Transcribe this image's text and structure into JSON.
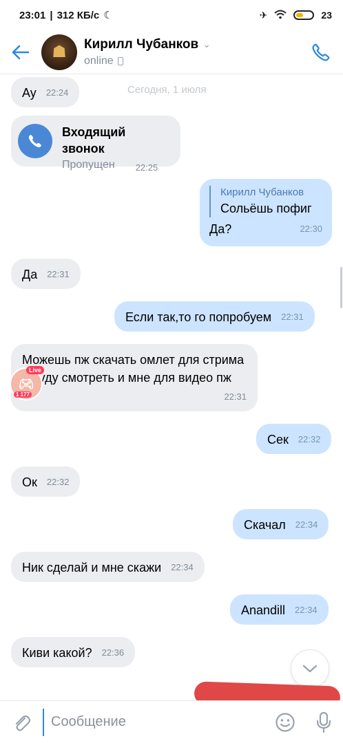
{
  "status_bar": {
    "time": "23:01",
    "speed": "312 КБ/с",
    "battery": "23"
  },
  "header": {
    "back_label": "←",
    "avatar_glyph": "☗",
    "name": "Кирилл Чубанков",
    "status": "online"
  },
  "date_label": "Сегодня, 1 июля",
  "messages": [
    {
      "text": "Ау",
      "time": "22:24"
    },
    {
      "call_title": "Входящий звонок",
      "call_status": "Пропущен",
      "time": "22:25"
    },
    {
      "reply_author": "Кирилл Чубанков",
      "reply_text": "Сольёшь пофиг",
      "text": "Да?",
      "time": "22:30"
    },
    {
      "text": "Да",
      "time": "22:31"
    },
    {
      "text": "Если так,то го попробуем",
      "time": "22:31"
    },
    {
      "text": "Можешь пж скачать омлет для стрима я буду смотреть и мне для видео пж",
      "time": "22:31"
    },
    {
      "text": "Сек",
      "time": "22:32"
    },
    {
      "text": "Ок",
      "time": "22:32"
    },
    {
      "text": "Скачал",
      "time": "22:34"
    },
    {
      "text": "Ник сделай и мне скажи",
      "time": "22:34"
    },
    {
      "text": "Anandill",
      "time": "22:34"
    },
    {
      "text": "Киви какой?",
      "time": "22:36"
    }
  ],
  "live_badge": {
    "tag": "Live",
    "count": "1 177"
  },
  "composer": {
    "placeholder": "Сообщение"
  },
  "colors": {
    "accent": "#2b88e2",
    "incoming_bubble": "#ebedf0",
    "outgoing_bubble": "#cce4ff",
    "redaction": "#e04848"
  }
}
